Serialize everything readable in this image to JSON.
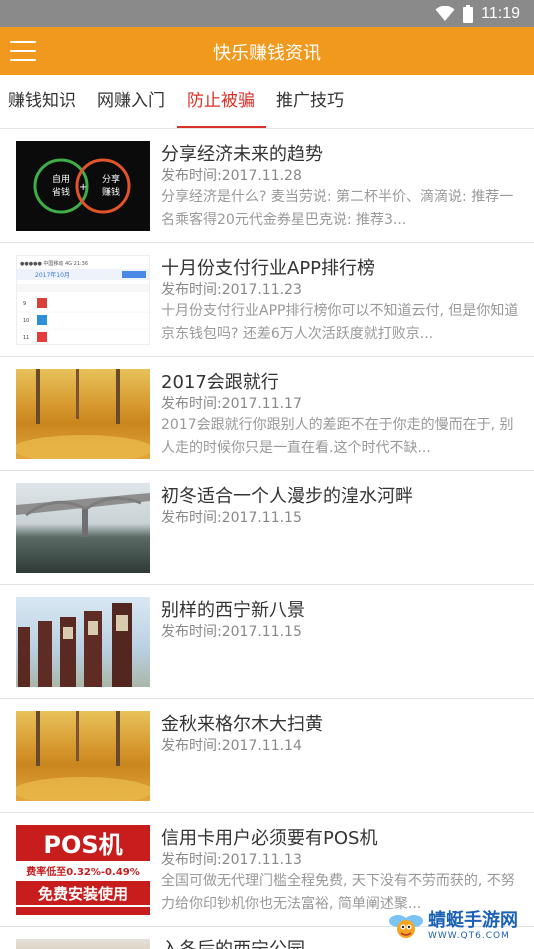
{
  "status": {
    "time": "11:19"
  },
  "header": {
    "title": "快乐赚钱资讯"
  },
  "tabs": [
    {
      "label": "赚钱知识"
    },
    {
      "label": "网赚入门"
    },
    {
      "label": "防止被骗",
      "active": true
    },
    {
      "label": "推广技巧"
    }
  ],
  "articles": [
    {
      "title": "分享经济未来的趋势",
      "date": "发布时间:2017.11.28",
      "desc": "分享经济是什么? 麦当劳说: 第二杯半价、滴滴说: 推荐一名乘客得20元代金券星巴克说: 推荐3...",
      "thumb": {
        "left_label_1": "自用",
        "left_label_2": "省钱",
        "right_label_1": "分享",
        "right_label_2": "赚钱",
        "plus": "+"
      }
    },
    {
      "title": "十月份支付行业APP排行榜",
      "date": "发布时间:2017.11.23",
      "desc": "十月份支付行业APP排行榜你可以不知道云付, 但是你知道京东钱包吗? 还差6万人次活跃度就打败京...",
      "thumb": {
        "bar": "●●●●● 中国移动  4G      21:36",
        "header": "2017年10月",
        "rows": [
          "9",
          "10",
          "11"
        ]
      }
    },
    {
      "title": "2017会跟就行",
      "date": "发布时间:2017.11.17",
      "desc": "2017会跟就行你跟别人的差距不在于你走的慢而在于, 别人走的时候你只是一直在看.这个时代不缺..."
    },
    {
      "title": "初冬适合一个人漫步的湟水河畔",
      "date": "发布时间:2017.11.15",
      "desc": ""
    },
    {
      "title": "别样的西宁新八景",
      "date": "发布时间:2017.11.15",
      "desc": ""
    },
    {
      "title": "金秋来格尔木大扫黄",
      "date": "发布时间:2017.11.14",
      "desc": ""
    },
    {
      "title": "信用卡用户必须要有POS机",
      "date": "发布时间:2017.11.13",
      "desc": "全国可做无代理门槛全程免费, 天下没有不劳而获的, 不努力给你印钞机你也无法富裕, 简单阐述聚...",
      "thumb": {
        "line1": "POS机",
        "line2": "费率低至0.32%-0.49%",
        "line3": "免费安装使用"
      }
    },
    {
      "title": "入冬后的西宁公园",
      "date": "",
      "desc": ""
    }
  ],
  "watermark": {
    "name": "蜻蜓手游网",
    "url": "WWW.QT6.COM"
  },
  "colors": {
    "accent": "#f0991d",
    "active_tab": "#d9302a"
  }
}
